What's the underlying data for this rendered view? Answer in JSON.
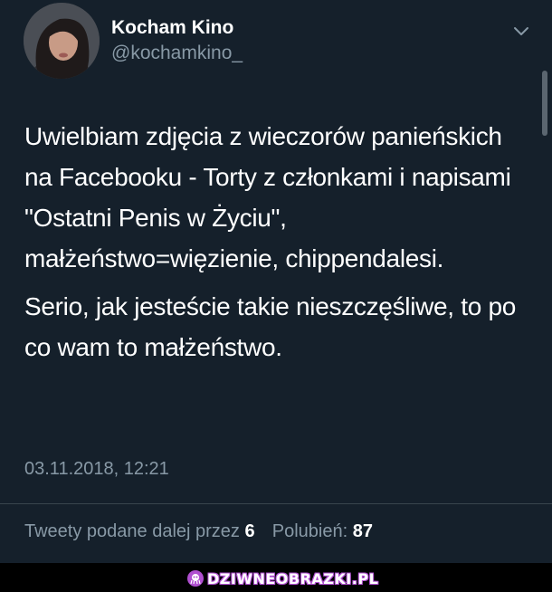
{
  "tweet": {
    "author": {
      "display_name": "Kocham Kino",
      "handle": "@kochamkino_",
      "avatar_icon": "profile-photo"
    },
    "text_paragraphs": [
      "Uwielbiam zdjęcia z wieczorów panieńskich na Facebooku - Torty z członkami i napisami \"Ostatni Penis w Życiu\", małżeństwo=więzienie, chippendalesi.",
      "Serio, jak jesteście takie nieszczęśliwe, to po co wam to małżeństwo."
    ],
    "timestamp": "03.11.2018, 12:21",
    "stats": {
      "retweets_label": "Tweety podane dalej przez",
      "retweets_count": "6",
      "likes_label": "Polubień:",
      "likes_count": "87"
    }
  },
  "footer": {
    "watermark": "DZIWNEOBRAZKI.PL"
  },
  "colors": {
    "background": "#15202b",
    "secondary_text": "#8899a6",
    "divider": "#38444d",
    "watermark_accent": "#b04fd0"
  }
}
